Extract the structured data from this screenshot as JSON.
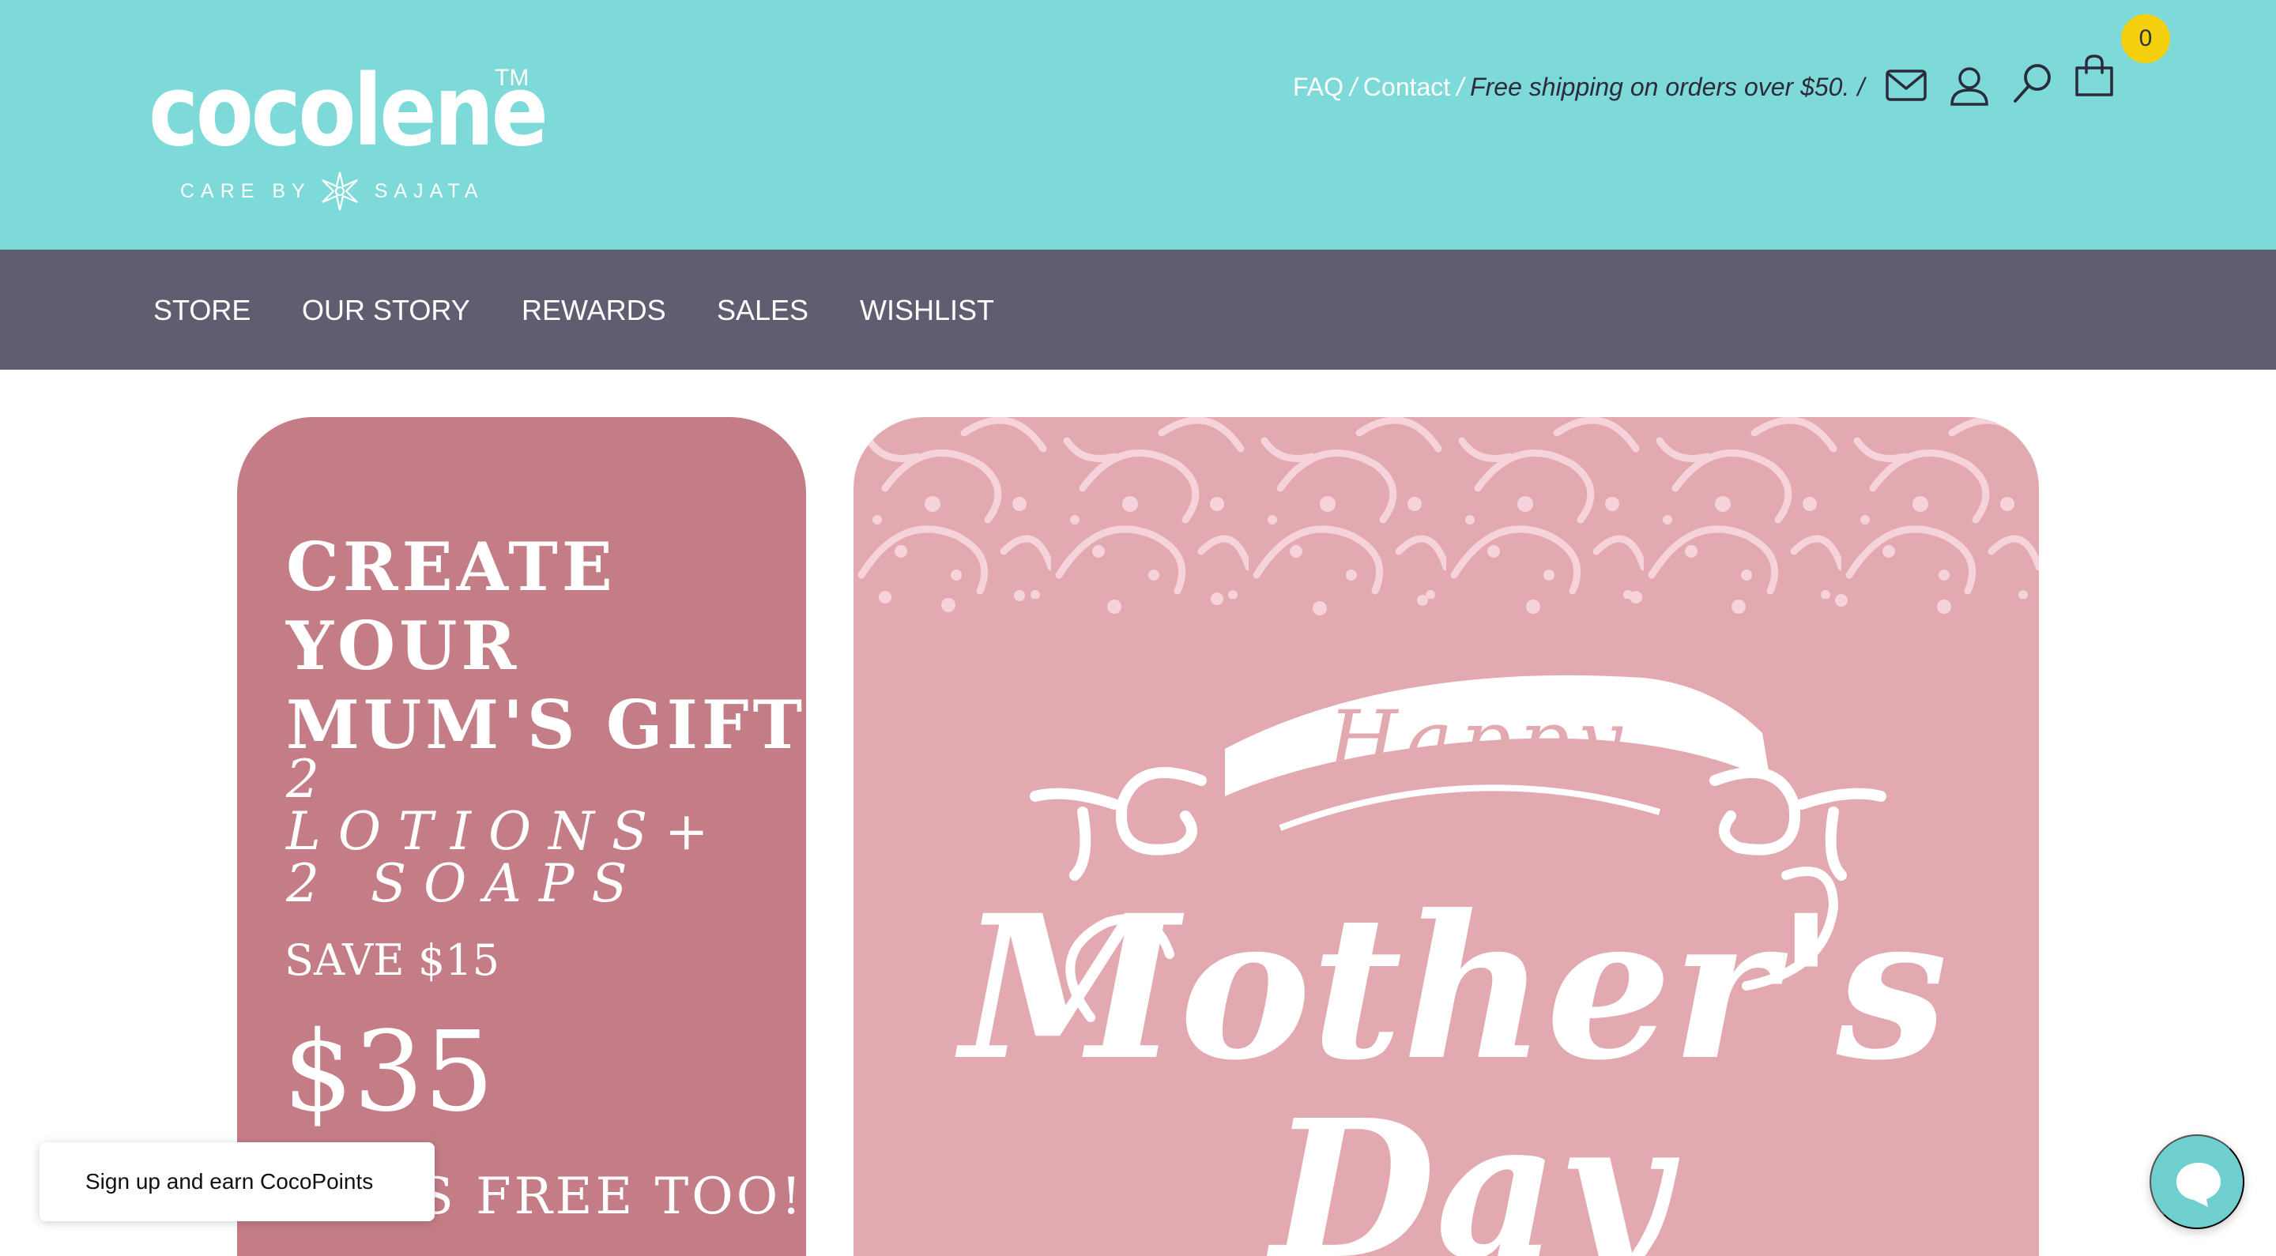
{
  "brand": {
    "name": "cocolene",
    "trademark": "TM",
    "tagline_left": "CARE BY",
    "tagline_right": "SAJATA"
  },
  "utility": {
    "faq": "FAQ",
    "separator": "/",
    "contact": "Contact",
    "shipping": "Free shipping on orders over $50.",
    "cart_count": "0"
  },
  "icons": {
    "mail": "mail-icon",
    "account": "user-icon",
    "search": "search-icon",
    "cart": "shopping-bag-icon"
  },
  "nav": {
    "items": [
      {
        "label": "STORE"
      },
      {
        "label": "OUR STORY"
      },
      {
        "label": "REWARDS"
      },
      {
        "label": "SALES"
      },
      {
        "label": "WISHLIST"
      }
    ]
  },
  "promo": {
    "title": "CREATE YOUR MUM'S GIFT",
    "offer": "2 LOTIONS+\n2 SOAPS",
    "save": "SAVE $15",
    "price": "$35",
    "free_text": "S FREE TOO!"
  },
  "hero": {
    "line1": "Happy",
    "line2": "Mother's",
    "line3": "Day"
  },
  "widgets": {
    "signup": "Sign up and earn CocoPoints"
  },
  "colors": {
    "header_bg": "#7ddad9",
    "nav_bg": "#5f5d70",
    "promo_bg": "#c47d86",
    "hero_bg": "#e3a9b0",
    "badge": "#f4d00e",
    "chat": "#6fcfcf"
  }
}
